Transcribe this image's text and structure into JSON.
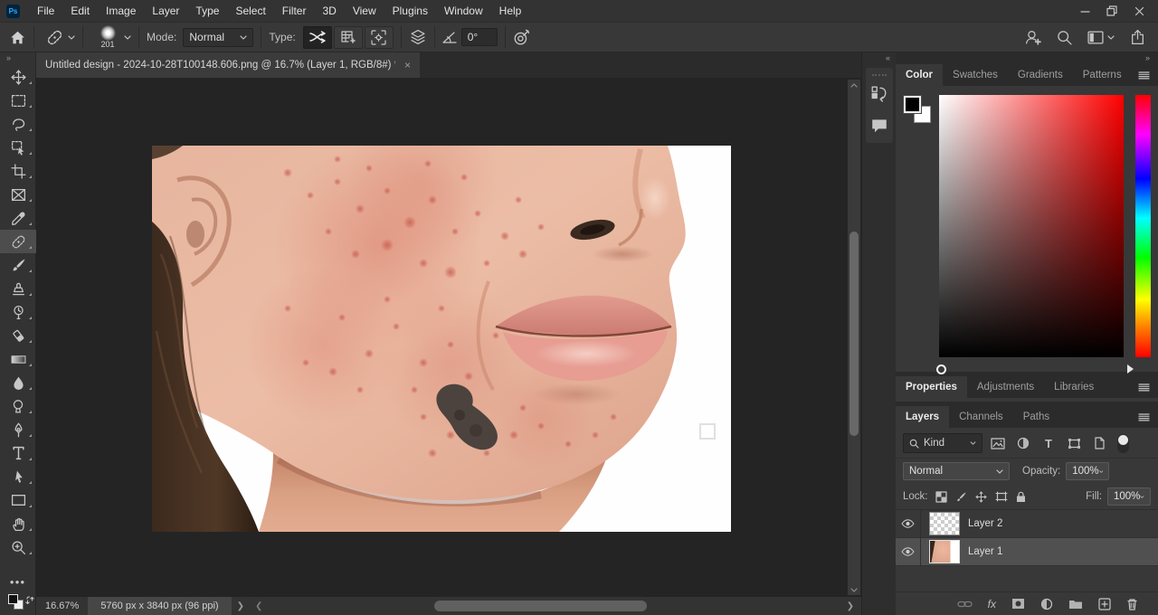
{
  "app": {
    "logo_text": "Ps"
  },
  "menu": {
    "items": [
      "File",
      "Edit",
      "Image",
      "Layer",
      "Type",
      "Select",
      "Filter",
      "3D",
      "View",
      "Plugins",
      "Window",
      "Help"
    ]
  },
  "options": {
    "brush_size": "201",
    "mode_label": "Mode:",
    "mode_value": "Normal",
    "type_label": "Type:",
    "angle_value": "0°"
  },
  "document": {
    "tab_title": "Untitled design - 2024-10-28T100148.606.png @ 16.7% (Layer 1, RGB/8#) *",
    "close_glyph": "×"
  },
  "status": {
    "zoom": "16.67%",
    "doc_info": "5760 px x 3840 px (96 ppi)"
  },
  "glyphs": {
    "collapse_right": "»",
    "collapse_left": "«",
    "more_tools": "●●●",
    "fx": "fx",
    "type_filter": "T"
  },
  "toolbar": {
    "tools": [
      "move-tool",
      "rectangular-marquee-tool",
      "lasso-tool",
      "object-selection-tool",
      "crop-tool",
      "frame-tool",
      "eyedropper-tool",
      "spot-healing-brush-tool",
      "brush-tool",
      "clone-stamp-tool",
      "history-brush-tool",
      "eraser-tool",
      "gradient-tool",
      "blur-tool",
      "dodge-tool",
      "pen-tool",
      "type-tool",
      "path-selection-tool",
      "rectangle-tool",
      "hand-tool",
      "zoom-tool"
    ],
    "selected_tool": "spot-healing-brush-tool"
  },
  "color_panel": {
    "tabs": [
      "Color",
      "Swatches",
      "Gradients",
      "Patterns"
    ],
    "active_tab": "Color",
    "foreground": "#000000",
    "background": "#ffffff",
    "hue_top": "#ff0000"
  },
  "properties_panel": {
    "tabs": [
      "Properties",
      "Adjustments",
      "Libraries"
    ],
    "active_tab": "Properties"
  },
  "layers_panel": {
    "tabs": [
      "Layers",
      "Channels",
      "Paths"
    ],
    "active_tab": "Layers",
    "filter_label": "Kind",
    "blend_mode": "Normal",
    "opacity_label": "Opacity:",
    "opacity_value": "100%",
    "lock_label": "Lock:",
    "fill_label": "Fill:",
    "fill_value": "100%",
    "layers": [
      {
        "name": "Layer 2",
        "selected": false,
        "thumb": "transparent-checker"
      },
      {
        "name": "Layer 1",
        "selected": true,
        "thumb": "face-photo"
      }
    ]
  },
  "colors": {
    "accent_blue": "#31a8ff",
    "panel_bg": "#383838",
    "workspace_bg": "#242424"
  }
}
